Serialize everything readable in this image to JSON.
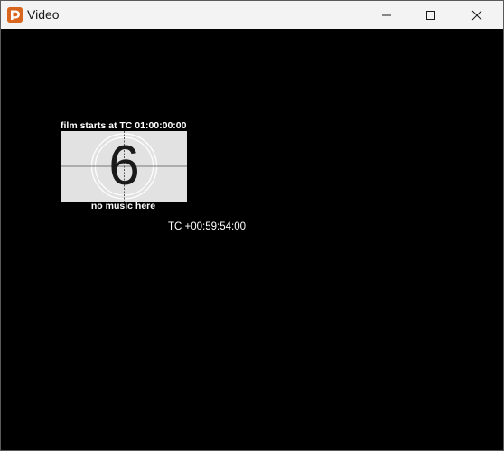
{
  "window": {
    "title": "Video",
    "icon": "app-logo-icon",
    "controls": {
      "minimize": "minimize-icon",
      "maximize": "maximize-icon",
      "close": "close-icon"
    }
  },
  "video": {
    "caption_top": "film starts at TC 01:00:00:00",
    "countdown_number": "6",
    "caption_bottom": "no music here",
    "timecode": "TC +00:59:54:00"
  },
  "colors": {
    "background": "#000000",
    "titlebar": "#f3f3f3",
    "icon_accent": "#d9661f",
    "leader_frame": "#e4e4e4"
  }
}
